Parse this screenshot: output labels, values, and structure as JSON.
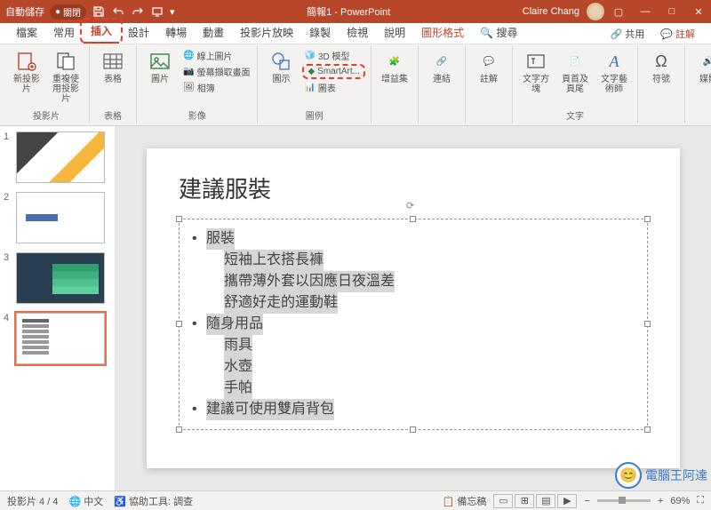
{
  "titlebar": {
    "autosave_label": "自動儲存",
    "autosave_state": "關閉",
    "doc_title": "簡報1 - PowerPoint",
    "user_name": "Claire Chang"
  },
  "tabs": {
    "file": "檔案",
    "home": "常用",
    "insert": "插入",
    "design": "設計",
    "transition": "轉場",
    "animation": "動畫",
    "slideshow": "投影片放映",
    "record": "錄製",
    "review": "檢視",
    "help": "說明",
    "shape_format": "圖形格式",
    "search_placeholder": "搜尋",
    "share": "共用",
    "comments": "註解"
  },
  "ribbon": {
    "slides": {
      "new_slide": "新投影片",
      "reuse": "重複使用投影片",
      "group": "投影片"
    },
    "tables": {
      "table": "表格",
      "group": "表格"
    },
    "images": {
      "pictures": "圖片",
      "online_pic": "線上圖片",
      "screenshot": "螢幕擷取畫面",
      "album": "相簿",
      "group": "影像"
    },
    "illus": {
      "shapes": "圖示",
      "3d": "3D 模型",
      "smartart": "SmartArt...",
      "chart": "圖表",
      "group": "圖例"
    },
    "addins": {
      "addins": "增益集"
    },
    "links": {
      "link": "連結"
    },
    "comment": {
      "comment": "註解"
    },
    "text": {
      "textbox": "文字方塊",
      "header": "頁首及頁尾",
      "wordart": "文字藝術師",
      "group": "文字"
    },
    "symbols": {
      "symbol": "符號"
    },
    "media": {
      "media": "媒體"
    }
  },
  "thumbs": [
    "1",
    "2",
    "3",
    "4"
  ],
  "slide": {
    "title": "建議服裝",
    "items": [
      {
        "level": 0,
        "text": "服裝"
      },
      {
        "level": 1,
        "text": "短袖上衣搭長褲"
      },
      {
        "level": 1,
        "text": "攜帶薄外套以因應日夜溫差"
      },
      {
        "level": 1,
        "text": "舒適好走的運動鞋"
      },
      {
        "level": 0,
        "text": "隨身用品"
      },
      {
        "level": 1,
        "text": "雨具"
      },
      {
        "level": 1,
        "text": "水壺"
      },
      {
        "level": 1,
        "text": "手帕"
      },
      {
        "level": 0,
        "text": "建議可使用雙肩背包"
      }
    ]
  },
  "status": {
    "slide_of": "投影片 4 / 4",
    "lang": "中文",
    "a11y": "協助工具: 調查",
    "notes": "備忘稿",
    "zoom": "69%"
  },
  "watermark": "電腦王阿達"
}
